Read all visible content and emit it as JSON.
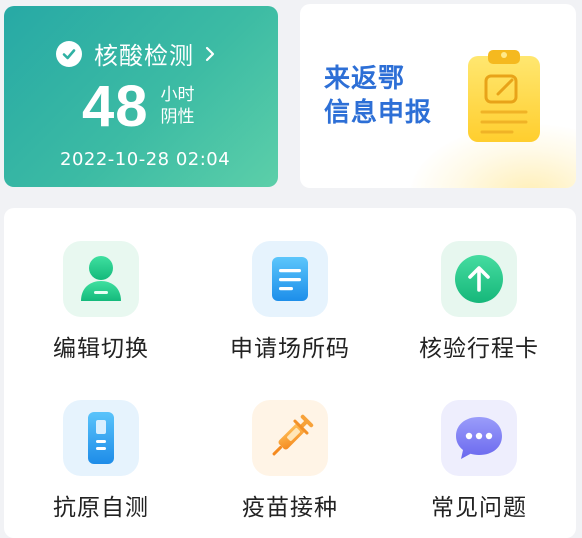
{
  "nucleic_test": {
    "title": "核酸检测",
    "hours": "48",
    "hours_unit": "小时",
    "result": "阴性",
    "datetime": "2022-10-28 02:04",
    "icons": [
      "check-icon",
      "chevron-right-icon"
    ]
  },
  "report_card": {
    "line1": "来返鄂",
    "line2": "信息申报",
    "icon": "clipboard-icon"
  },
  "services": [
    {
      "label": "编辑切换",
      "icon": "person-icon",
      "color": "#1fcf8f"
    },
    {
      "label": "申请场所码",
      "icon": "document-icon",
      "color": "#2ea6f0"
    },
    {
      "label": "核验行程卡",
      "icon": "arrow-up-icon",
      "color": "#2fc98a"
    },
    {
      "label": "抗原自测",
      "icon": "test-kit-icon",
      "color": "#3aa8ef"
    },
    {
      "label": "疫苗接种",
      "icon": "syringe-icon",
      "color": "#f59c2c"
    },
    {
      "label": "常见问题",
      "icon": "chat-bubble-icon",
      "color": "#7b7cf2"
    }
  ],
  "colors": {
    "test_card": "#38b7a5",
    "report_text": "#2d6fd6",
    "background": "#f1f2f5"
  }
}
